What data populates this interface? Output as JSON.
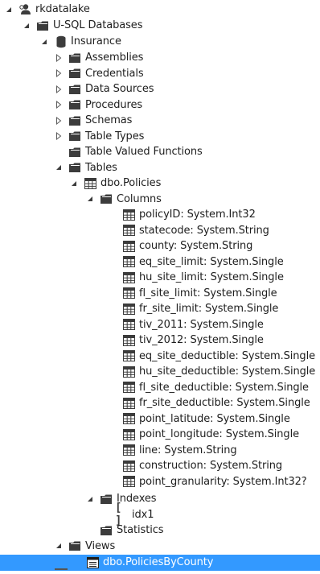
{
  "tree": {
    "root": {
      "label": "rkdatalake",
      "expanded": true,
      "icon": "account-icon"
    },
    "usql": {
      "label": "U-SQL Databases",
      "expanded": true,
      "icon": "folder-icon"
    },
    "db": {
      "label": "Insurance",
      "expanded": true,
      "icon": "database-icon"
    },
    "db_folders": [
      {
        "label": "Assemblies",
        "expanded": false,
        "icon": "folder-icon"
      },
      {
        "label": "Credentials",
        "expanded": false,
        "icon": "folder-icon"
      },
      {
        "label": "Data Sources",
        "expanded": false,
        "icon": "folder-icon"
      },
      {
        "label": "Procedures",
        "expanded": false,
        "icon": "folder-icon"
      },
      {
        "label": "Schemas",
        "expanded": false,
        "icon": "folder-icon"
      },
      {
        "label": "Table Types",
        "expanded": false,
        "icon": "folder-icon"
      },
      {
        "label": "Table Valued Functions",
        "expanded": null,
        "icon": "folder-icon"
      }
    ],
    "tables": {
      "label": "Tables",
      "expanded": true,
      "icon": "folder-icon"
    },
    "table": {
      "label": "dbo.Policies",
      "expanded": true,
      "icon": "table-icon"
    },
    "columns_folder": {
      "label": "Columns",
      "expanded": true,
      "icon": "folder-icon"
    },
    "columns": [
      "policyID: System.Int32",
      "statecode: System.String",
      "county: System.String",
      "eq_site_limit: System.Single",
      "hu_site_limit: System.Single",
      "fl_site_limit: System.Single",
      "fr_site_limit: System.Single",
      "tiv_2011: System.Single",
      "tiv_2012: System.Single",
      "eq_site_deductible: System.Single",
      "hu_site_deductible: System.Single",
      "fl_site_deductible: System.Single",
      "fr_site_deductible: System.Single",
      "point_latitude: System.Single",
      "point_longitude: System.Single",
      "line: System.String",
      "construction: System.String",
      "point_granularity: System.Int32?"
    ],
    "indexes_folder": {
      "label": "Indexes",
      "expanded": true,
      "icon": "folder-icon"
    },
    "index": {
      "label": "idx1",
      "icon": "index-brackets-icon"
    },
    "statistics": {
      "label": "Statistics",
      "icon": "folder-icon"
    },
    "views": {
      "label": "Views",
      "expanded": true,
      "icon": "folder-icon"
    },
    "view": {
      "label": "dbo.PoliciesByCounty",
      "icon": "view-icon",
      "selected": true
    }
  },
  "colors": {
    "selection": "#3399ff",
    "text": "#1e1e1e",
    "icon": "#3c3c3c"
  }
}
